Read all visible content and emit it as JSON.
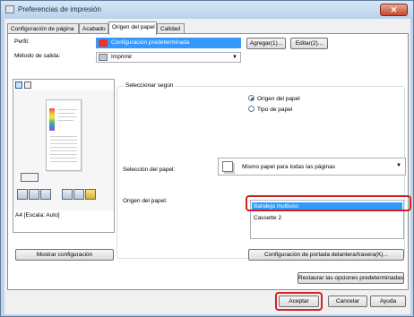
{
  "window": {
    "title": "Preferencias de impresión",
    "close_glyph": "✕"
  },
  "tabs": [
    {
      "label": "Configuración de página"
    },
    {
      "label": "Acabado"
    },
    {
      "label": "Origen del papel"
    },
    {
      "label": "Calidad"
    }
  ],
  "perfil": {
    "label": "Perfil:",
    "value": "Configuración predeterminada",
    "add_button": "Agregar(1)...",
    "edit_button": "Editar(2)..."
  },
  "output": {
    "label": "Método de salida:",
    "value": "Imprimir"
  },
  "preview": {
    "size_label": "A4 [Escala: Auto]"
  },
  "group": {
    "title": "Seleccionar según",
    "options": [
      {
        "label": "Origen del papel",
        "selected": true
      },
      {
        "label": "Tipo de papel",
        "selected": false
      }
    ]
  },
  "paper_selection": {
    "label": "Selección del papel:",
    "value": "Mismo papel para todas las páginas"
  },
  "paper_source": {
    "label": "Origen del papel:",
    "items": [
      {
        "label": "Bandeja multiuso",
        "selected": true
      },
      {
        "label": "Cassette 2",
        "selected": false
      }
    ]
  },
  "buttons": {
    "show_config": "Mostrar configuración",
    "cover_config": "Configuración de portada delantera/trasera(K)...",
    "restore": "Restaurar las opciones predeterminadas",
    "ok": "Aceptar",
    "cancel": "Cancelar",
    "help": "Ayuda"
  },
  "colors": {
    "highlight": "#d32020",
    "selection": "#3399ff"
  }
}
